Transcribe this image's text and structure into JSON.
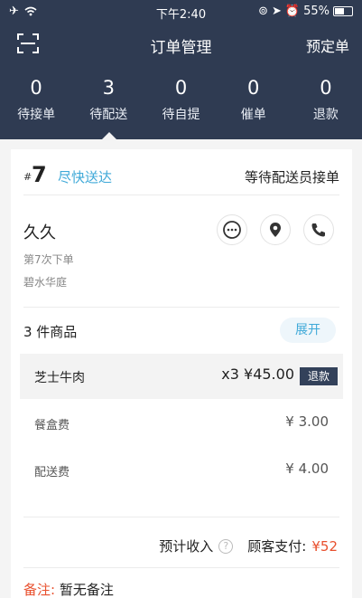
{
  "status_bar": {
    "time": "下午2:40",
    "battery": "55%",
    "battery_level": 0.55
  },
  "navbar": {
    "title": "订单管理",
    "right_action": "预定单",
    "scan_icon": "scan-icon"
  },
  "tabs": [
    {
      "count": "0",
      "label": "待接单"
    },
    {
      "count": "3",
      "label": "待配送"
    },
    {
      "count": "0",
      "label": "待自提"
    },
    {
      "count": "0",
      "label": "催单"
    },
    {
      "count": "0",
      "label": "退款"
    }
  ],
  "order": {
    "hash": "#",
    "number": "7",
    "delivery_type": "尽快送达",
    "status": "等待配送员接单"
  },
  "customer": {
    "name": "久久",
    "order_count": "第7次下单",
    "address": "碧水华庭",
    "icons": [
      "chat-icon",
      "location-icon",
      "phone-icon"
    ]
  },
  "items": {
    "title": "3 件商品",
    "expand_label": "展开",
    "list": [
      {
        "name": "芝士牛肉",
        "qty_price": "x3 ¥45.00",
        "refund_label": "退款"
      }
    ]
  },
  "fees": [
    {
      "label": "餐盒费",
      "value": "¥ 3.00"
    },
    {
      "label": "配送费",
      "value": "¥ 4.00"
    }
  ],
  "summary": {
    "income_label": "预计收入",
    "customer_pay_label": "顾客支付:",
    "customer_pay_value": "¥52"
  },
  "note": {
    "label": "备注:",
    "text": "暂无备注"
  },
  "colors": {
    "header_bg": "#2f3b52",
    "accent_blue": "#3fa9d8",
    "accent_red": "#e8502e"
  }
}
